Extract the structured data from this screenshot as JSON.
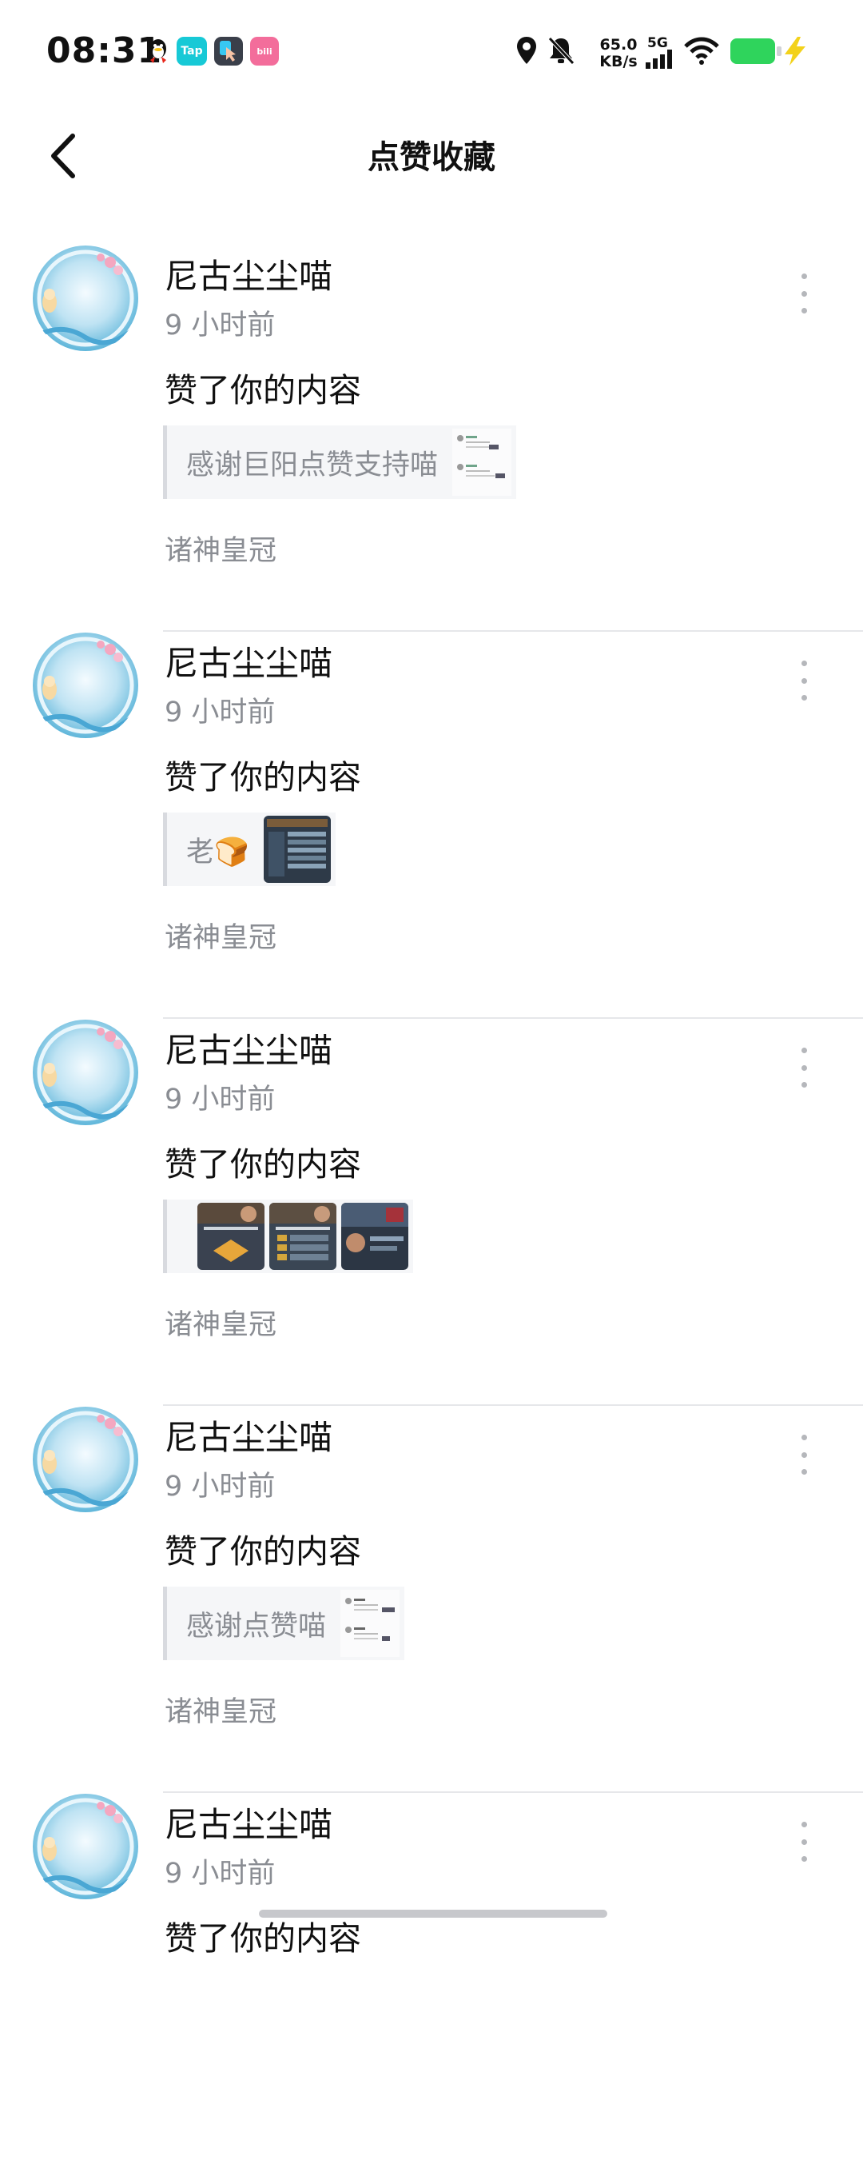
{
  "status_bar": {
    "time": "08:31",
    "net_speed_value": "65.0",
    "net_speed_unit": "KB/s",
    "network_type": "5G",
    "app_icons": [
      "qq-icon",
      "taptap-icon",
      "pointer-app-icon",
      "bilibili-icon"
    ],
    "status_icons": [
      "location-icon",
      "mute-bell-icon",
      "signal-bars-icon",
      "wifi-icon",
      "battery-icon",
      "charging-icon"
    ]
  },
  "header": {
    "title": "点赞收藏",
    "back_icon": "chevron-left-icon"
  },
  "notifications": [
    {
      "user": "尼古尘尘喵",
      "time": "9 小时前",
      "action": "赞了你的内容",
      "quote": "感谢巨阳点赞支持喵",
      "circle": "诸神皇冠"
    },
    {
      "user": "尼古尘尘喵",
      "time": "9 小时前",
      "action": "赞了你的内容",
      "quote": "老🍞",
      "circle": "诸神皇冠"
    },
    {
      "user": "尼古尘尘喵",
      "time": "9 小时前",
      "action": "赞了你的内容",
      "quote": "",
      "circle": "诸神皇冠"
    },
    {
      "user": "尼古尘尘喵",
      "time": "9 小时前",
      "action": "赞了你的内容",
      "quote": "感谢点赞喵",
      "circle": "诸神皇冠"
    },
    {
      "user": "尼古尘尘喵",
      "time": "9 小时前",
      "action": "赞了你的内容",
      "quote": "",
      "circle": ""
    }
  ],
  "colors": {
    "accent_green": "#2fd45c",
    "text_primary": "#111111",
    "text_secondary": "#8a8d93",
    "divider": "#e6e7ea"
  }
}
